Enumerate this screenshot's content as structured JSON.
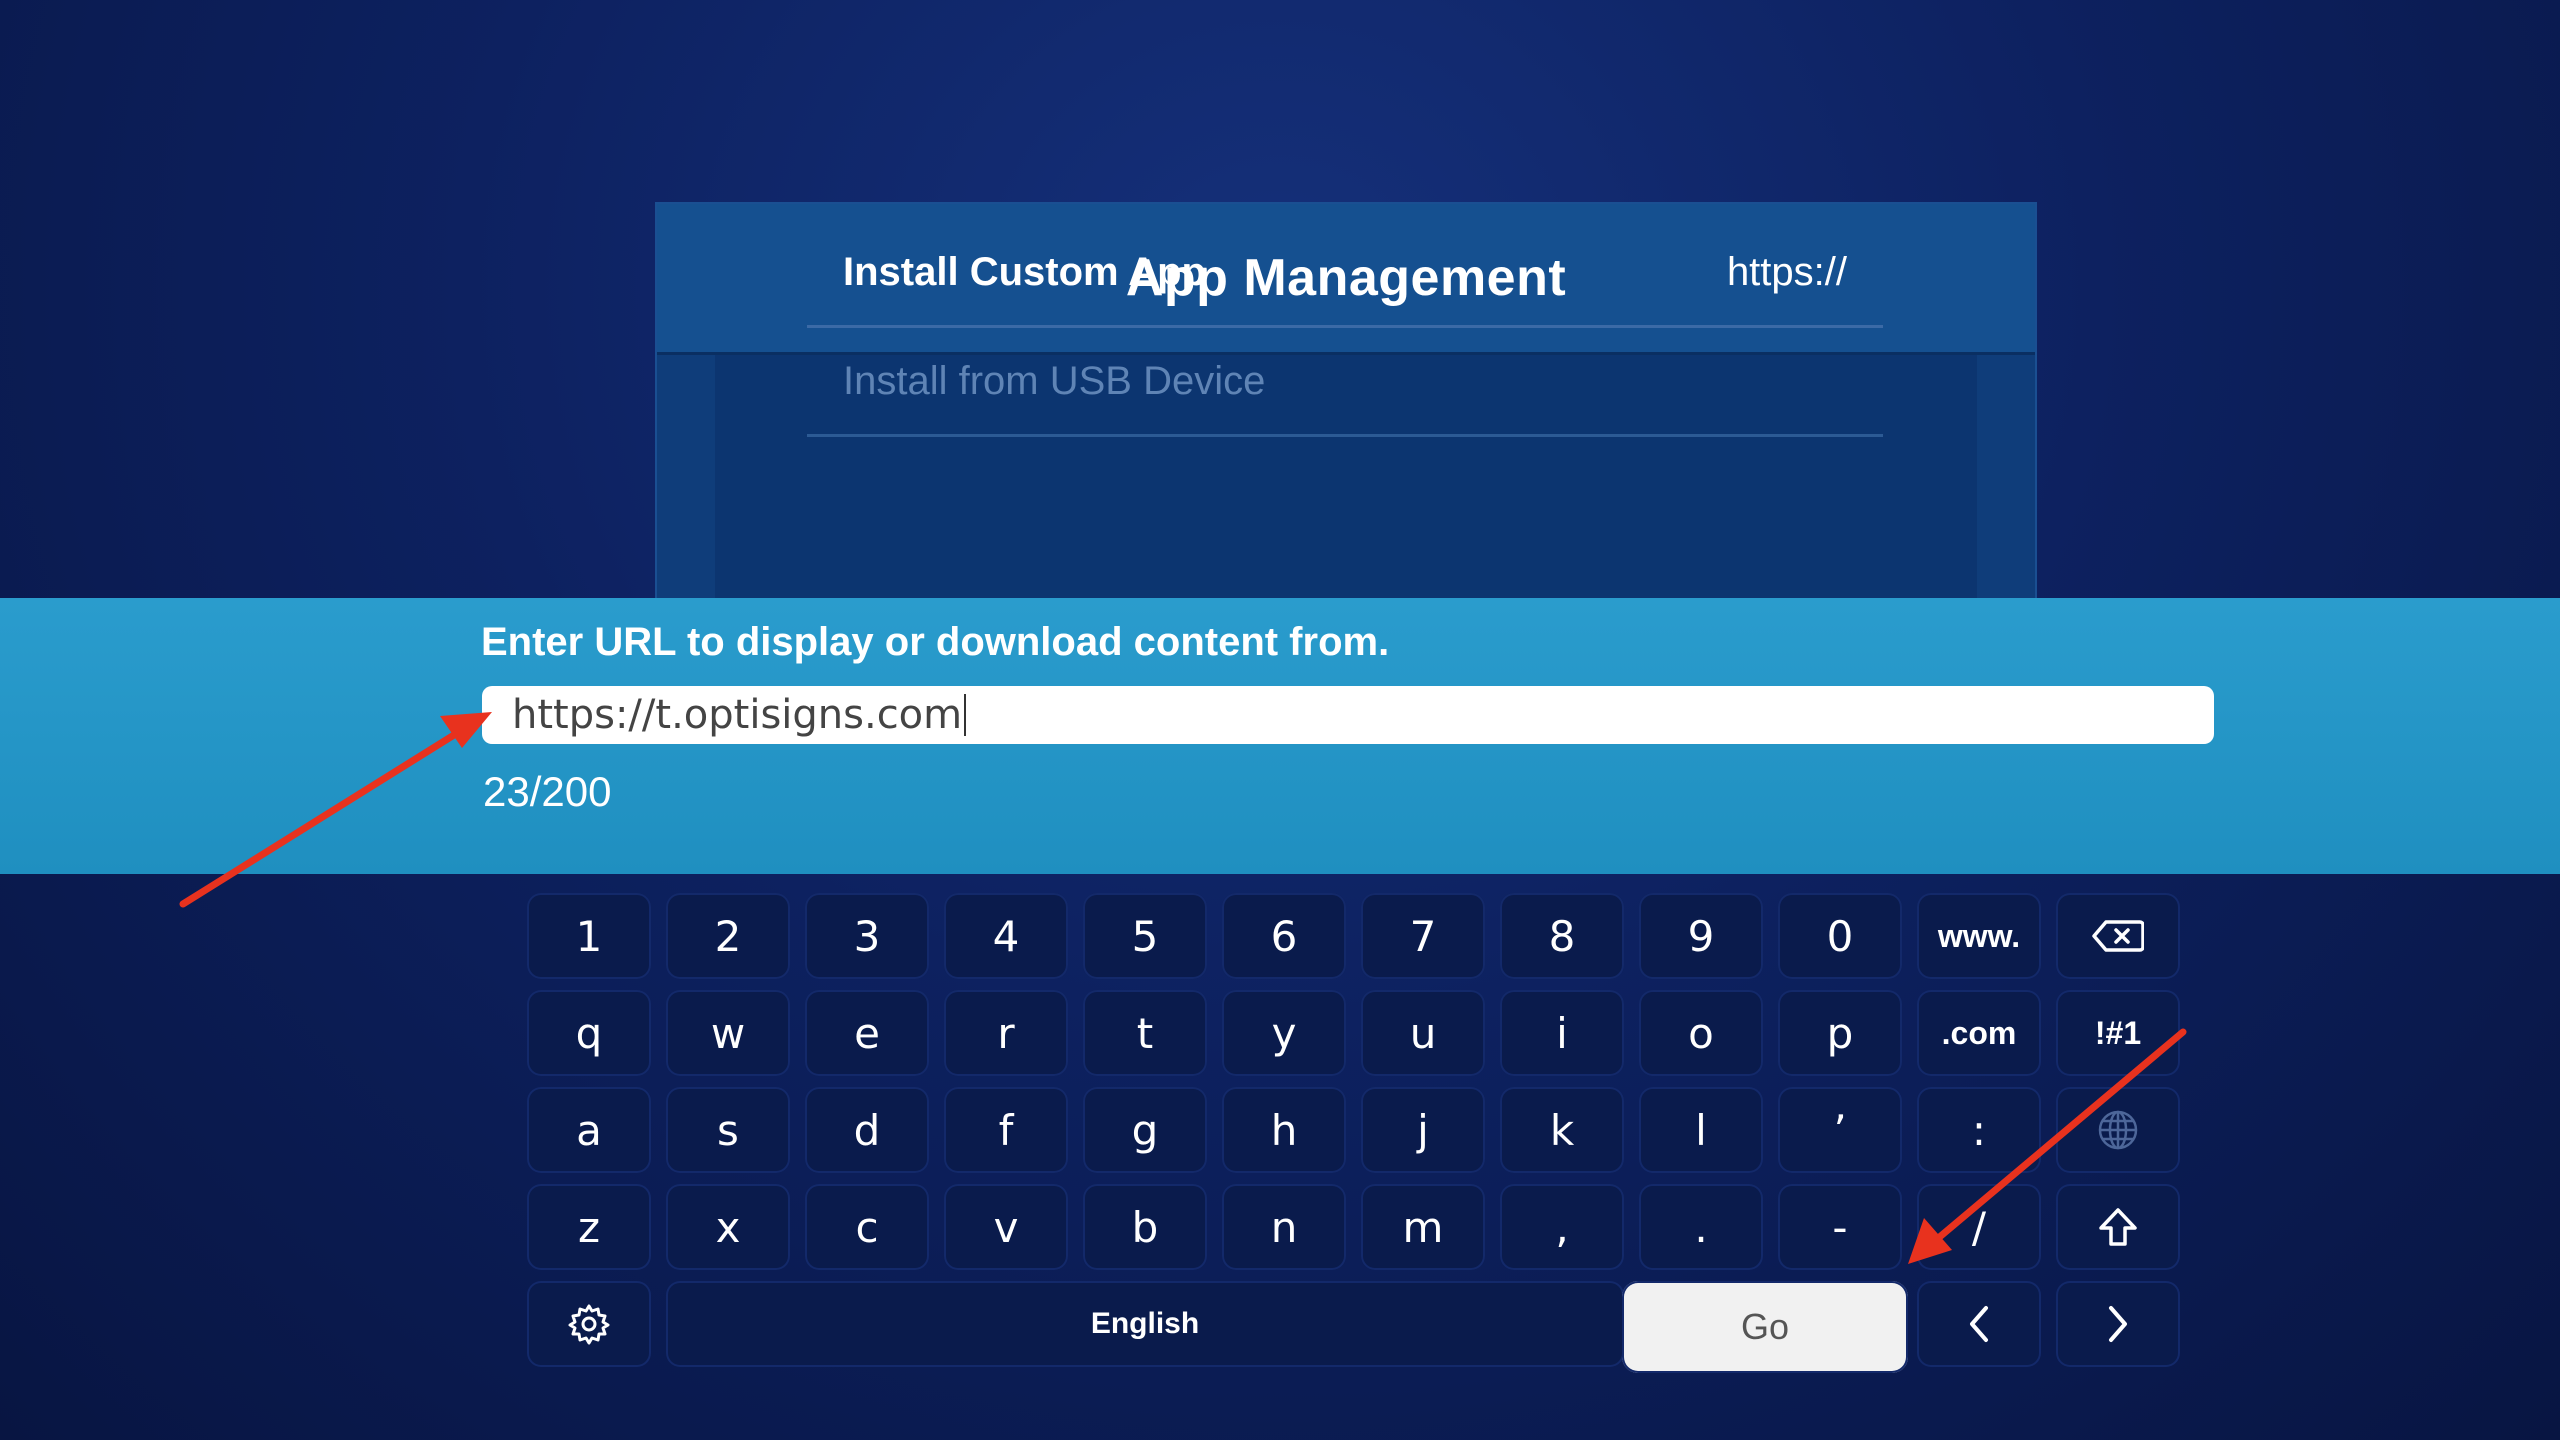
{
  "dialog": {
    "title": "App Management",
    "rows": [
      {
        "label": "Install Custom App",
        "value": "https://"
      },
      {
        "label": "Install from USB Device"
      }
    ]
  },
  "input_panel": {
    "prompt": "Enter URL to display or download content from.",
    "url_value": "https://t.optisigns.com",
    "counter": "23/200"
  },
  "keyboard": {
    "row1": [
      "1",
      "2",
      "3",
      "4",
      "5",
      "6",
      "7",
      "8",
      "9",
      "0",
      "www."
    ],
    "row2": [
      "q",
      "w",
      "e",
      "r",
      "t",
      "y",
      "u",
      "i",
      "o",
      "p",
      ".com",
      "!#1"
    ],
    "row3": [
      "a",
      "s",
      "d",
      "f",
      "g",
      "h",
      "j",
      "k",
      "l",
      "’",
      ":"
    ],
    "row4": [
      "z",
      "x",
      "c",
      "v",
      "b",
      "n",
      "m",
      ",",
      ".",
      "-",
      "/"
    ],
    "language": "English",
    "go": "Go",
    "icons": {
      "backspace": "backspace-icon",
      "globe": "globe-icon",
      "shift": "shift-icon",
      "settings": "gear-icon",
      "left": "chevron-left-icon",
      "right": "chevron-right-icon"
    }
  },
  "annotation_color": "#e8321e"
}
